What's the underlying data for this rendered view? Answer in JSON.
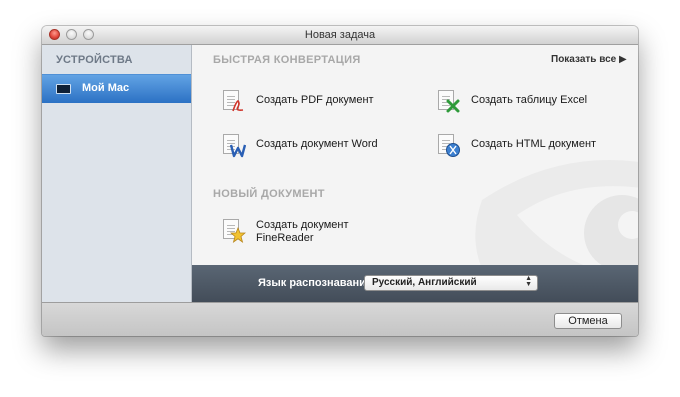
{
  "window": {
    "title": "Новая задача"
  },
  "sidebar": {
    "header": "УСТРОЙСТВА",
    "items": [
      {
        "label": "Мой Mac",
        "selected": true,
        "icon": "monitor-icon"
      }
    ]
  },
  "quick_conversion": {
    "title": "БЫСТРАЯ КОНВЕРТАЦИЯ",
    "show_all": "Показать все",
    "show_all_icon": "triangle-right-icon",
    "actions": [
      {
        "label": "Создать PDF документ",
        "icon": "pdf-document-icon"
      },
      {
        "label": "Создать таблицу Excel",
        "icon": "excel-document-icon"
      },
      {
        "label": "Создать документ Word",
        "icon": "word-document-icon"
      },
      {
        "label": "Создать HTML документ",
        "icon": "html-document-icon"
      }
    ]
  },
  "new_document": {
    "title": "НОВЫЙ ДОКУМЕНТ",
    "actions": [
      {
        "label_line1": "Создать документ",
        "label_line2": "FineReader",
        "icon": "finereader-document-icon"
      }
    ]
  },
  "recognition": {
    "label": "Язык распознавания:",
    "selected_value": "Русский, Английский"
  },
  "footer": {
    "cancel_label": "Отмена"
  },
  "colors": {
    "selection_blue": "#2b71c4",
    "status_bar": "#4b5663",
    "close_red": "#e0443a"
  }
}
